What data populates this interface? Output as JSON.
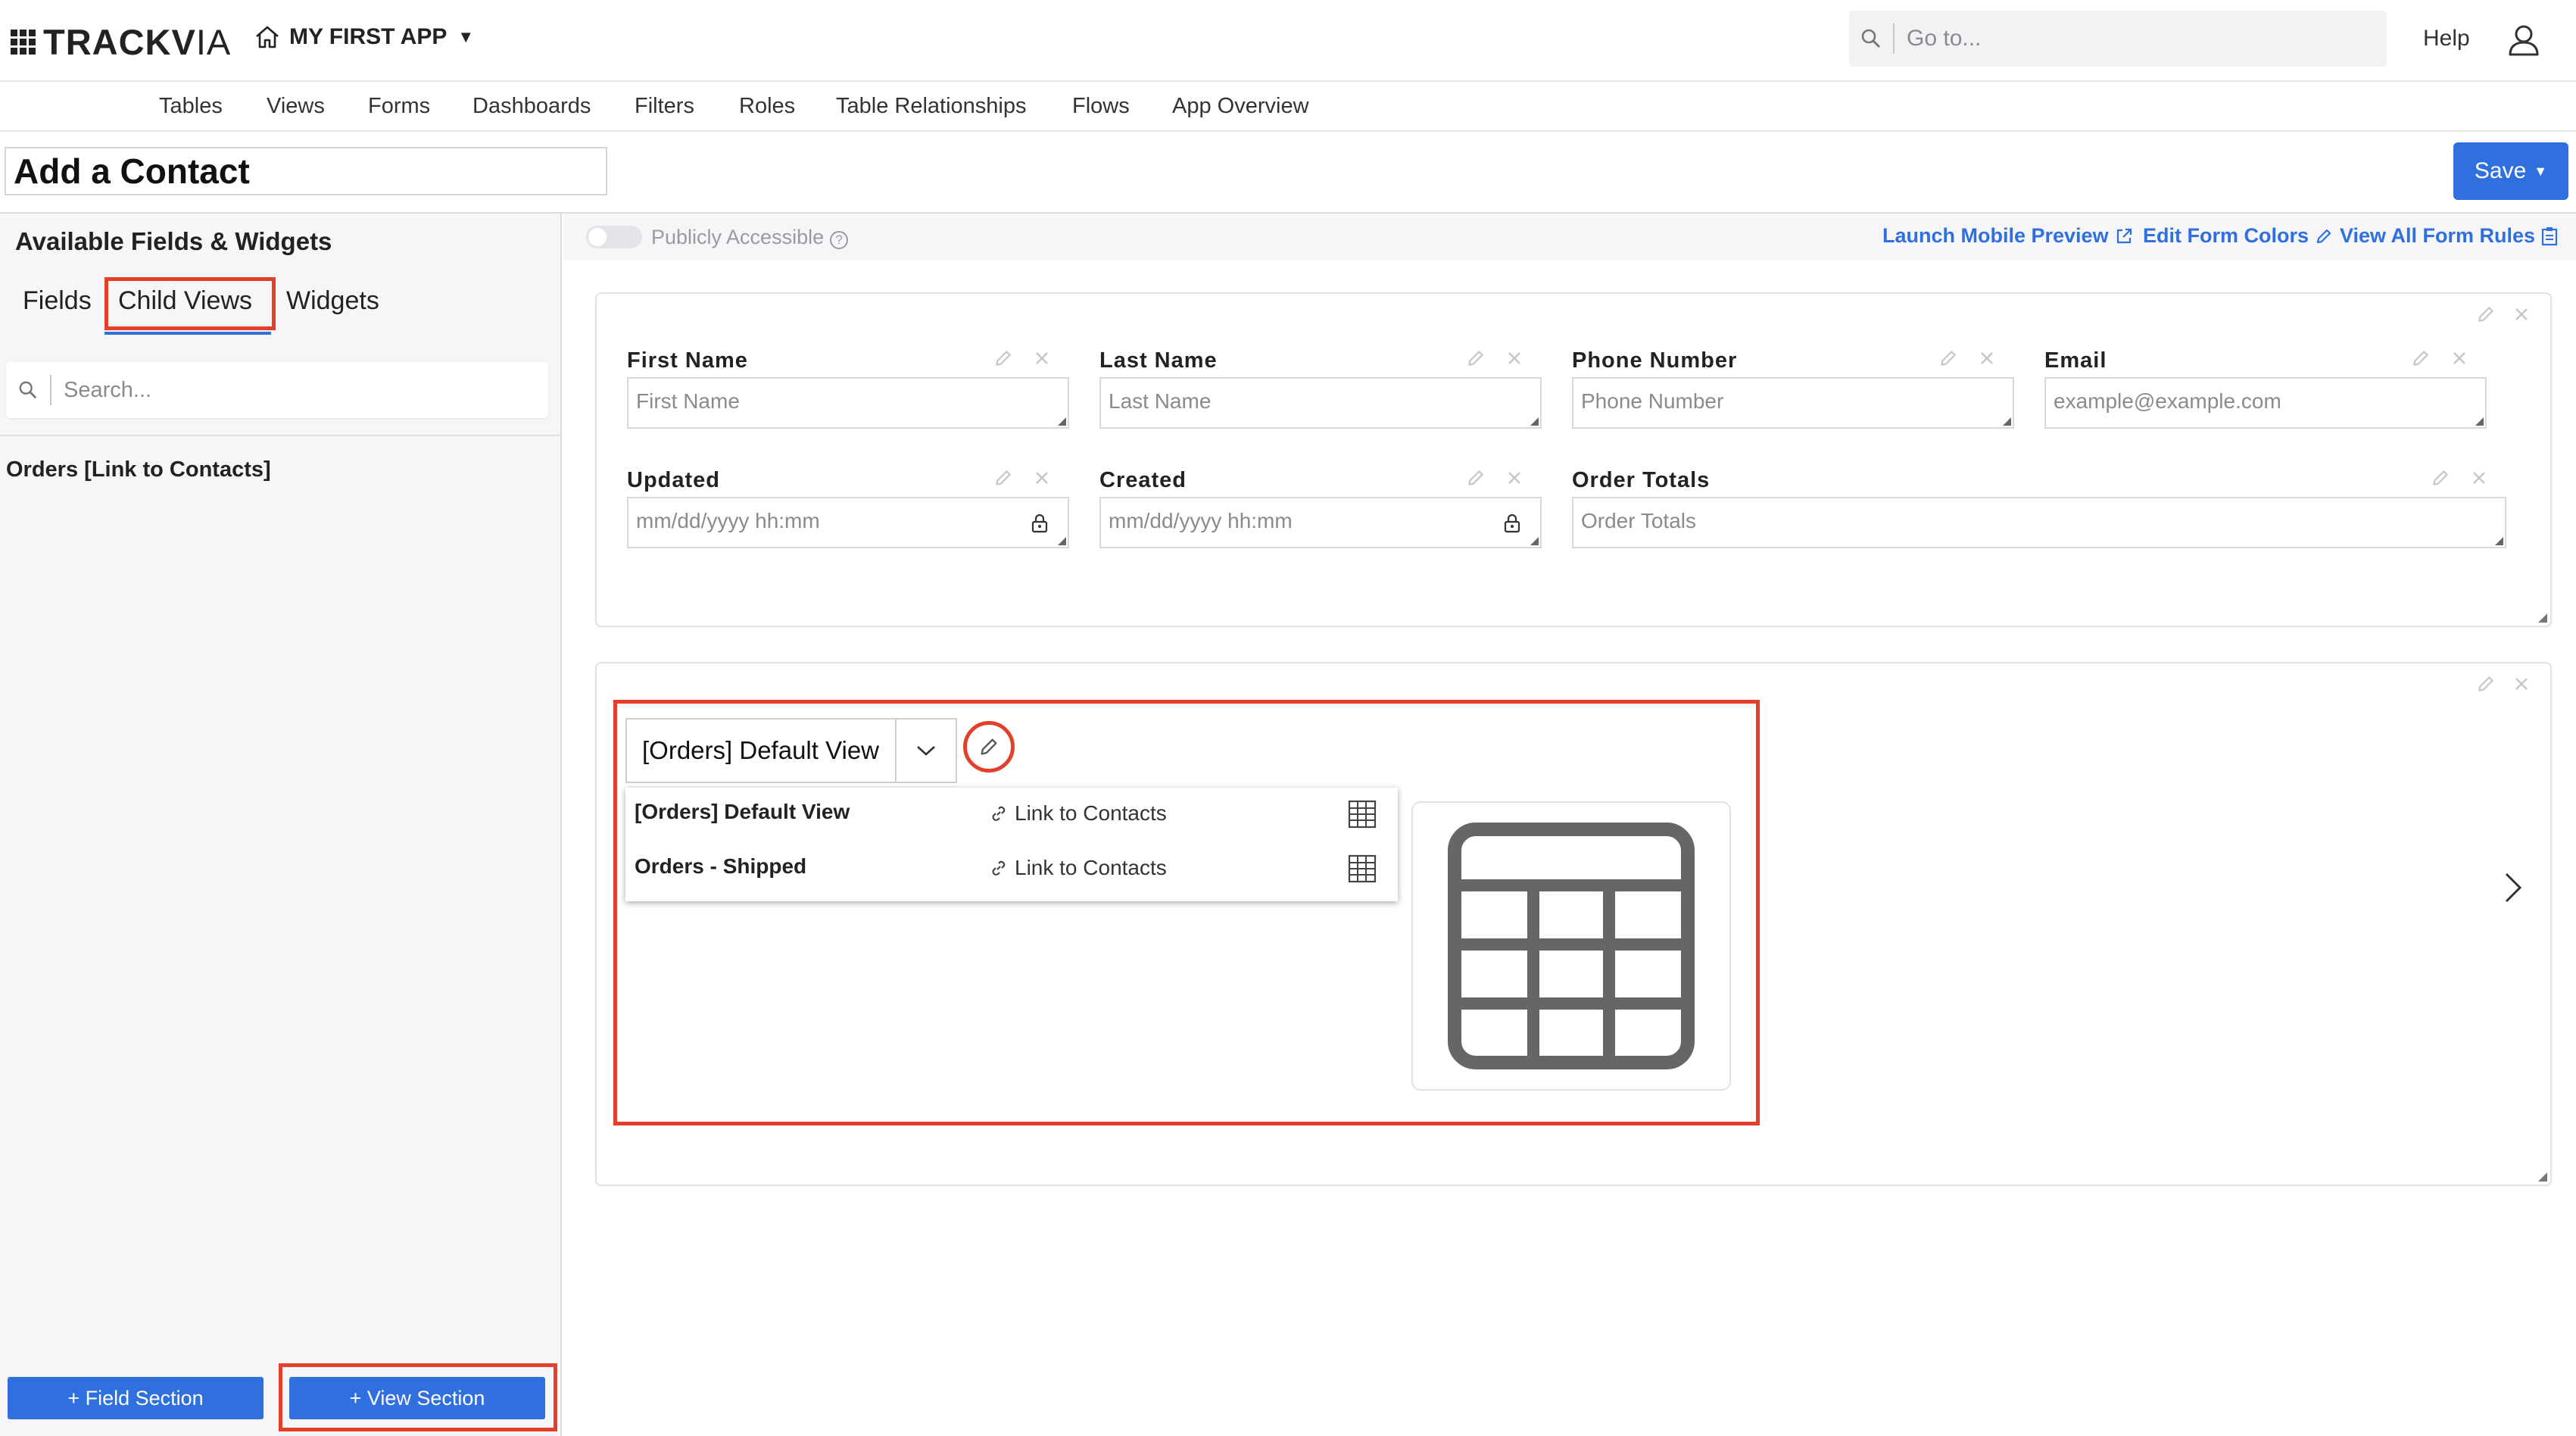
{
  "header": {
    "logo_bold": "TRACKV",
    "logo_light": "IA",
    "app_name": "MY FIRST APP",
    "goto_placeholder": "Go to...",
    "help_label": "Help"
  },
  "nav": {
    "items": [
      "Tables",
      "Views",
      "Forms",
      "Dashboards",
      "Filters",
      "Roles",
      "Table Relationships",
      "Flows",
      "App Overview"
    ]
  },
  "form": {
    "title": "Add a Contact",
    "save_label": "Save"
  },
  "sidebar": {
    "heading": "Available Fields & Widgets",
    "tabs": [
      "Fields",
      "Child Views",
      "Widgets"
    ],
    "active_tab": "Child Views",
    "search_placeholder": "Search...",
    "items": [
      "Orders [Link to Contacts]"
    ],
    "field_section_button": "+ Field Section",
    "view_section_button": "+ View Section"
  },
  "toolbar": {
    "public_label": "Publicly Accessible",
    "launch_preview": "Launch Mobile Preview",
    "edit_colors": "Edit Form Colors",
    "view_rules": "View All Form Rules"
  },
  "fields": [
    {
      "label": "First Name",
      "placeholder": "First Name",
      "locked": false
    },
    {
      "label": "Last Name",
      "placeholder": "Last Name",
      "locked": false
    },
    {
      "label": "Phone Number",
      "placeholder": "Phone Number",
      "locked": false
    },
    {
      "label": "Email",
      "placeholder": "example@example.com",
      "locked": false
    },
    {
      "label": "Updated",
      "placeholder": "mm/dd/yyyy hh:mm",
      "locked": true
    },
    {
      "label": "Created",
      "placeholder": "mm/dd/yyyy hh:mm",
      "locked": true
    },
    {
      "label": "Order Totals",
      "placeholder": "Order Totals",
      "locked": false
    }
  ],
  "view_section": {
    "selected_view": "[Orders] Default View",
    "options": [
      {
        "name": "[Orders] Default View",
        "link": "Link to Contacts"
      },
      {
        "name": "Orders - Shipped",
        "link": "Link to Contacts"
      }
    ]
  },
  "colors": {
    "accent": "#2f6fde",
    "highlight": "#e2402b",
    "sidebar_bg": "#f6f6f8"
  },
  "icons": [
    "home-icon",
    "search-icon",
    "user-icon",
    "pencil-icon",
    "close-icon",
    "lock-icon",
    "link-icon",
    "table-icon",
    "chevron-down-icon",
    "chevron-right-icon",
    "external-link-icon",
    "clipboard-icon",
    "help-circle-icon"
  ]
}
